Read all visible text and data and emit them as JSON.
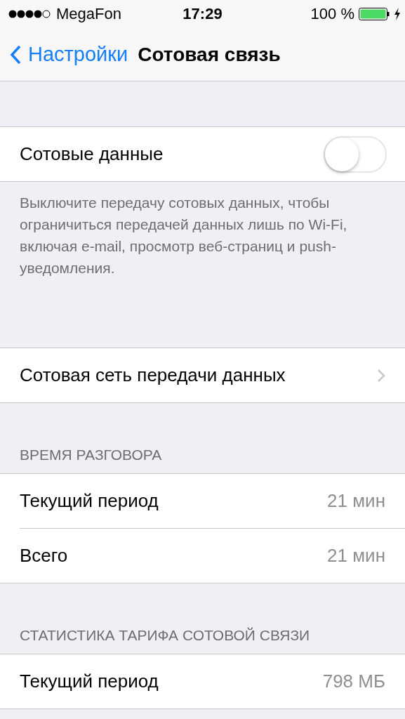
{
  "status_bar": {
    "carrier": "MegaFon",
    "time": "17:29",
    "battery": "100 %"
  },
  "nav": {
    "back": "Настройки",
    "title": "Сотовая связь"
  },
  "sections": [
    {
      "rows": [
        {
          "kind": "toggle",
          "label": "Сотовые данные",
          "on": false
        }
      ],
      "footer": "Выключите передачу сотовых данных, чтобы ограничиться передачей данных лишь по Wi-Fi, включая e-mail, просмотр веб-страниц и push-уведомления."
    },
    {
      "rows": [
        {
          "kind": "link",
          "label": "Сотовая сеть передачи данных"
        }
      ]
    },
    {
      "header": "ВРЕМЯ РАЗГОВОРА",
      "rows": [
        {
          "kind": "value",
          "label": "Текущий период",
          "value": "21 мин"
        },
        {
          "kind": "value",
          "label": "Всего",
          "value": "21 мин"
        }
      ]
    },
    {
      "header": "СТАТИСТИКА ТАРИФА СОТОВОЙ СВЯЗИ",
      "rows": [
        {
          "kind": "value",
          "label": "Текущий период",
          "value": "798 МБ"
        }
      ]
    }
  ]
}
